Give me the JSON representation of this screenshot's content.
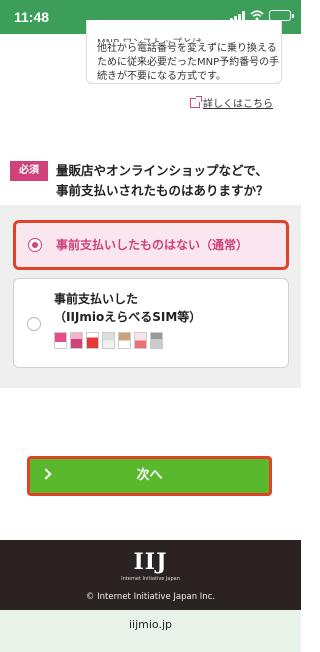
{
  "status_bar": {
    "time": "11:48",
    "background": "#3c9e58",
    "icons": [
      "signal-icon",
      "wifi-icon",
      "battery-icon"
    ]
  },
  "info_box": {
    "cut_line": "MNP ワンストップとは",
    "lines": [
      "他社から電話番号を変えずに乗り換える",
      "ために従来必要だったMNP予約番号の手",
      "続きが不要になる方式です。"
    ]
  },
  "more_link": {
    "label": "詳しくはこちら",
    "icon": "external-link-icon"
  },
  "question": {
    "required_badge": "必須",
    "text_line1": "量販店やオンラインショップなどで、",
    "text_line2": "事前支払いされたものはありますか？"
  },
  "options": [
    {
      "label": "事前支払いしたものはない（通常）",
      "selected": true
    },
    {
      "label_line1": "事前支払いした",
      "label_line2": "（IIJmioえらべるSIM等）",
      "selected": false
    }
  ],
  "next_button": {
    "label": "次へ",
    "color": "#5ab82c",
    "highlight": "#e04328"
  },
  "footer": {
    "logo": "IIJ",
    "tagline": "Internet Initiative Japan",
    "copyright": "© Internet Initiative Japan Inc."
  },
  "url_bar": {
    "url": "iijmio.jp"
  },
  "colors": {
    "accent_pink": "#d0427a",
    "highlight_red": "#e04328"
  }
}
